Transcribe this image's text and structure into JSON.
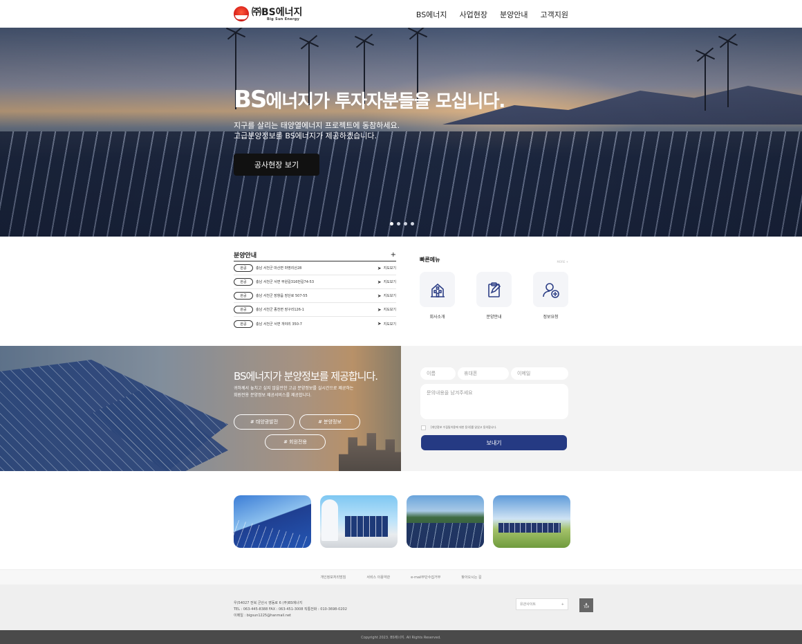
{
  "header": {
    "logo_main": "㈜BS에너지",
    "logo_sub": "Big Sun Energy",
    "nav": [
      "BS에너지",
      "사업현장",
      "분양안내",
      "고객지원"
    ]
  },
  "hero": {
    "title_big": "BS",
    "title_rest": "에너지가 투자자분들을 모십니다.",
    "sub_line1": "지구를 살리는 태양열에너지 프로젝트에 동참하세요.",
    "sub_line2": "고급분양정보를 BS에너지가 제공하겠습니다.",
    "button": "공사현장 보기",
    "slide_count": 4,
    "active_slide": 1
  },
  "sale_list": {
    "title": "분양안내",
    "more": "+",
    "rows": [
      {
        "badge": "완공",
        "address": "충남 서천군 마산면 마명리산28",
        "map": "지도보기"
      },
      {
        "badge": "완공",
        "address": "충남 서천군 서면 부원길316번길74-53",
        "map": "지도보기"
      },
      {
        "badge": "완공",
        "address": "충남 서천군 장항읍 장산로 507-55",
        "map": "지도보기"
      },
      {
        "badge": "완공",
        "address": "충남 서천군 종천면 장구리126-1",
        "map": "지도보기"
      },
      {
        "badge": "완공",
        "address": "충남 서천군 서면 개야리 350-7",
        "map": "지도보기"
      }
    ]
  },
  "quick_menu": {
    "title": "빠른메뉴",
    "more": "MORE +",
    "items": [
      {
        "label": "회사소개",
        "icon": "building-icon"
      },
      {
        "label": "분양안내",
        "icon": "clipboard-edit-icon"
      },
      {
        "label": "정보요청",
        "icon": "user-add-icon"
      }
    ]
  },
  "promo": {
    "title": "BS에너지가 분양정보를 제공합니다.",
    "line1": "귀하께서 놓치고 싶지 않을만한 고급 분양정보를 실시간으로 제공하는",
    "line2": "회원전용 분양정보 제공서비스를 제공합니다.",
    "tags": [
      "# 태양광발전",
      "# 분양정보",
      "# 회원전용"
    ]
  },
  "form": {
    "name_placeholder": "이름",
    "phone_placeholder": "휴대폰",
    "email_placeholder": "이메일",
    "message_placeholder": "문의내용을 남겨주세요",
    "agree_text": "[개인정보 수집및이용에 대한 동의]를 읽었고 동의합니다.",
    "submit": "보내기"
  },
  "footer": {
    "links": [
      "개인정보처리방침",
      "서비스 이용약관",
      "e-mail무단수집거부",
      "찾아오시는 길"
    ],
    "line1": "우)54027    전북 군산시 영동로 6    (주)BS에너지",
    "line2": "TEL : 063-445-8388    FAX : 063-451-3008    직통전화 : 010-3698-0202",
    "line3": "이메일 : bigsun1225@hanmail.net",
    "family_site": "유관사이트",
    "family_arrow": "+",
    "top_arrow": "▲",
    "top_label": "TOP",
    "copyright": "Copyright 2023. BS에너지. All Rights Reserved."
  }
}
